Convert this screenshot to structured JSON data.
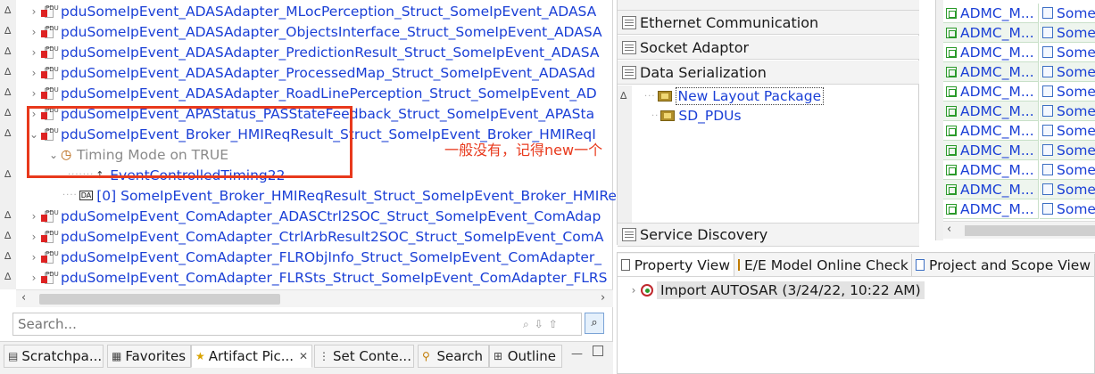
{
  "tree": {
    "rows": [
      {
        "label": "pduSomeIpEvent_ADASAdapter_MLocPerception_Struct_SomeIpEvent_ADASA",
        "type": "pdu"
      },
      {
        "label": "pduSomeIpEvent_ADASAdapter_ObjectsInterface_Struct_SomeIpEvent_ADASA",
        "type": "pdu"
      },
      {
        "label": "pduSomeIpEvent_ADASAdapter_PredictionResult_Struct_SomeIpEvent_ADASA",
        "type": "pdu"
      },
      {
        "label": "pduSomeIpEvent_ADASAdapter_ProcessedMap_Struct_SomeIpEvent_ADASAd",
        "type": "pdu"
      },
      {
        "label": "pduSomeIpEvent_ADASAdapter_RoadLinePerception_Struct_SomeIpEvent_AD",
        "type": "pdu"
      },
      {
        "label": "pduSomeIpEvent_APAStatus_PASStateFeedback_Struct_SomeIpEvent_APASta",
        "type": "pdu"
      },
      {
        "label": "pduSomeIpEvent_Broker_HMIReqResult_Struct_SomeIpEvent_Broker_HMIReqI",
        "type": "pdu"
      },
      {
        "label": "Timing Mode on TRUE",
        "type": "timing"
      },
      {
        "label": "EventControlledTiming22",
        "type": "event"
      },
      {
        "label": "[0] SomeIpEvent_Broker_HMIReqResult_Struct_SomeIpEvent_Broker_HMIRe",
        "type": "da"
      },
      {
        "label": "pduSomeIpEvent_ComAdapter_ADASCtrl2SOC_Struct_SomeIpEvent_ComAdap",
        "type": "pdu"
      },
      {
        "label": "pduSomeIpEvent_ComAdapter_CtrlArbResult2SOC_Struct_SomeIpEvent_ComA",
        "type": "pdu"
      },
      {
        "label": "pduSomeIpEvent_ComAdapter_FLRObjInfo_Struct_SomeIpEvent_ComAdapter_",
        "type": "pdu"
      },
      {
        "label": "pduSomeIpEvent_ComAdapter_FLRSts_Struct_SomeIpEvent_ComAdapter_FLRS",
        "type": "pdu"
      }
    ]
  },
  "annotation": {
    "text": "一般没有，记得new一个",
    "color": "#e8391c"
  },
  "search": {
    "placeholder": "Search..."
  },
  "bottom_tabs": [
    {
      "label": "Scratchpa..."
    },
    {
      "label": "Favorites"
    },
    {
      "label": "Artifact Pic...",
      "close": "✕"
    },
    {
      "label": "Set Conte..."
    },
    {
      "label": "Search"
    },
    {
      "label": "Outline"
    }
  ],
  "categories": {
    "headers": [
      "Ethernet Communication",
      "Socket Adaptor",
      "Data Serialization",
      "Service Discovery"
    ],
    "packages": [
      {
        "label": "New Layout Package"
      },
      {
        "label": "SD_PDUs"
      }
    ]
  },
  "admc_list": {
    "col1": "ADMC_M...",
    "col2": "Some",
    "row_count": 11
  },
  "property_panel": {
    "tabs": [
      "Property View",
      "E/E Model Online Check",
      "Project and Scope View"
    ],
    "history": "Import AUTOSAR (3/24/22, 10:22 AM)"
  }
}
